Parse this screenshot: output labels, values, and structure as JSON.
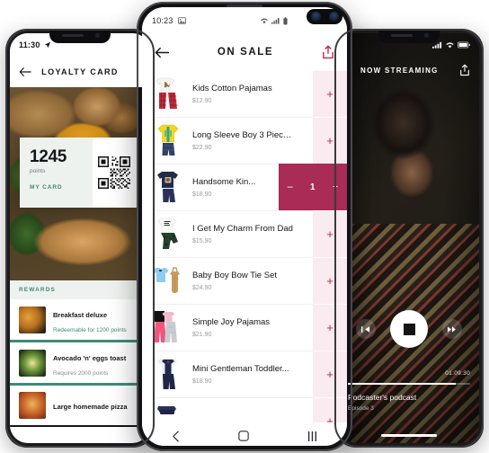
{
  "accent": {
    "crimson": "#b83a63",
    "crimson_dark": "#a82c55",
    "pink_bg": "#faebf0",
    "teal": "#3f8a79"
  },
  "loyalty_phone": {
    "status": {
      "time": "11:30",
      "location_icon": "location-arrow-icon"
    },
    "header": {
      "back_icon": "back-arrow-icon",
      "title": "LOYALTY CARD"
    },
    "card": {
      "points_value": "1245",
      "points_label": "points",
      "my_card_label": "MY CARD",
      "qr_icon": "qr-code-icon"
    },
    "rewards": {
      "section_label": "REWARDS",
      "items": [
        {
          "name": "Breakfast deluxe",
          "status": "Redeemable for 1200 points",
          "available": true
        },
        {
          "name": "Avocado 'n' eggs toast",
          "status": "Requires 2000 points",
          "available": false
        },
        {
          "name": "Large homemade pizza",
          "status": "",
          "available": false
        }
      ]
    }
  },
  "onsale_phone": {
    "status": {
      "time": "10:23",
      "image_icon": "image-icon",
      "wifi_icon": "wifi-icon",
      "signal_icon": "signal-icon",
      "battery_icon": "battery-icon"
    },
    "header": {
      "back_icon": "back-arrow-icon",
      "title": "ON SALE",
      "share_icon": "share-icon"
    },
    "products": [
      {
        "name": "Kids Cotton Pajamas",
        "price": "$12.90",
        "add_icon": "plus-icon",
        "in_cart": false
      },
      {
        "name": "Long Sleeve Boy 3 Piece...",
        "price": "$22.90",
        "add_icon": "plus-icon",
        "in_cart": false
      },
      {
        "name": "Handsome Kin...",
        "price": "$18.90",
        "add_icon": "plus-icon",
        "in_cart": true,
        "stepper": {
          "minus": "–",
          "qty": "1",
          "plus": "+"
        }
      },
      {
        "name": "I Get My Charm From Dad",
        "price": "$15.90",
        "add_icon": "plus-icon",
        "in_cart": false
      },
      {
        "name": "Baby Boy Bow Tie Set",
        "price": "$24.90",
        "add_icon": "plus-icon",
        "in_cart": false
      },
      {
        "name": "Simple Joy Pajamas",
        "price": "$21.90",
        "add_icon": "plus-icon",
        "in_cart": false
      },
      {
        "name": "Mini Gentleman Toddler...",
        "price": "$18.90",
        "add_icon": "plus-icon",
        "in_cart": false
      }
    ],
    "nav": {
      "back_icon": "android-back-icon",
      "home_icon": "android-home-icon",
      "recents_icon": "android-recents-icon"
    }
  },
  "streaming_phone": {
    "status": {
      "signal_icon": "signal-icon",
      "wifi_icon": "wifi-icon",
      "battery_icon": "battery-icon"
    },
    "header": {
      "title": "NOW STREAMING",
      "share_icon": "share-icon"
    },
    "controls": {
      "prev_icon": "previous-track-icon",
      "stop_icon": "stop-icon",
      "next_icon": "next-track-icon"
    },
    "timecode": "01:09:30",
    "podcast": {
      "title": "Podcaster's podcast",
      "episode": "Episode 3"
    }
  }
}
